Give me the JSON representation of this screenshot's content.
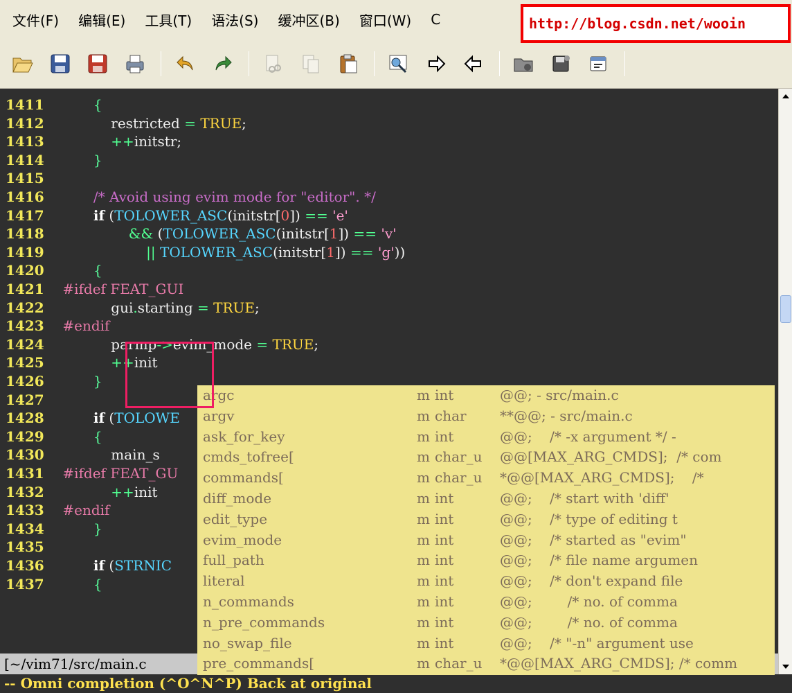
{
  "menu": {
    "items": [
      "文件(F)",
      "编辑(E)",
      "工具(T)",
      "语法(S)",
      "缓冲区(B)",
      "窗口(W)",
      "C"
    ],
    "url_overlay": "http://blog.csdn.net/wooin"
  },
  "toolbar": {
    "icons": [
      "open-icon",
      "save-icon",
      "save-all-icon",
      "print-icon",
      "undo-icon",
      "redo-icon",
      "cut-icon",
      "copy-icon",
      "paste-icon",
      "find-replace-icon",
      "forward-icon",
      "back-icon",
      "load-session-icon",
      "save-session-icon",
      "run-script-icon"
    ]
  },
  "editor": {
    "lines": [
      {
        "num": "1411",
        "code": [
          [
            "        ",
            ""
          ],
          [
            "{",
            "brace"
          ]
        ]
      },
      {
        "num": "1412",
        "code": [
          [
            "            restricted ",
            ""
          ],
          [
            "=",
            "op"
          ],
          [
            " ",
            ""
          ],
          [
            "TRUE",
            "const"
          ],
          [
            ";",
            ""
          ]
        ]
      },
      {
        "num": "1413",
        "code": [
          [
            "            ",
            ""
          ],
          [
            "++",
            "op"
          ],
          [
            "initstr;",
            ""
          ]
        ]
      },
      {
        "num": "1414",
        "code": [
          [
            "        ",
            ""
          ],
          [
            "}",
            "brace"
          ]
        ]
      },
      {
        "num": "1415",
        "code": []
      },
      {
        "num": "1416",
        "code": [
          [
            "        ",
            ""
          ],
          [
            "/* Avoid using evim mode for \"editor\". */",
            "cm"
          ]
        ]
      },
      {
        "num": "1417",
        "code": [
          [
            "        ",
            ""
          ],
          [
            "if",
            "kw"
          ],
          [
            " (",
            ""
          ],
          [
            "TOLOWER_ASC",
            "mac"
          ],
          [
            "(initstr[",
            ""
          ],
          [
            "0",
            "num"
          ],
          [
            "]) ",
            ""
          ],
          [
            "==",
            "op"
          ],
          [
            " ",
            ""
          ],
          [
            "'e'",
            "str"
          ]
        ]
      },
      {
        "num": "1418",
        "code": [
          [
            "                ",
            ""
          ],
          [
            "&&",
            "op"
          ],
          [
            " (",
            ""
          ],
          [
            "TOLOWER_ASC",
            "mac"
          ],
          [
            "(initstr[",
            ""
          ],
          [
            "1",
            "num"
          ],
          [
            "]) ",
            ""
          ],
          [
            "==",
            "op"
          ],
          [
            " ",
            ""
          ],
          [
            "'v'",
            "str"
          ]
        ]
      },
      {
        "num": "1419",
        "code": [
          [
            "                    ",
            ""
          ],
          [
            "||",
            "op"
          ],
          [
            " ",
            ""
          ],
          [
            "TOLOWER_ASC",
            "mac"
          ],
          [
            "(initstr[",
            ""
          ],
          [
            "1",
            "num"
          ],
          [
            "]) ",
            ""
          ],
          [
            "==",
            "op"
          ],
          [
            " ",
            ""
          ],
          [
            "'g'",
            "str"
          ],
          [
            "))",
            ""
          ]
        ]
      },
      {
        "num": "1420",
        "code": [
          [
            "        ",
            ""
          ],
          [
            "{",
            "brace"
          ]
        ]
      },
      {
        "num": "1421",
        "code": [
          [
            " ",
            ""
          ],
          [
            "#ifdef FEAT_GUI",
            "pp"
          ]
        ]
      },
      {
        "num": "1422",
        "code": [
          [
            "            gui",
            ""
          ],
          [
            ".",
            "op"
          ],
          [
            "starting ",
            ""
          ],
          [
            "=",
            "op"
          ],
          [
            " ",
            ""
          ],
          [
            "TRUE",
            "const"
          ],
          [
            ";",
            ""
          ]
        ]
      },
      {
        "num": "1423",
        "code": [
          [
            " ",
            ""
          ],
          [
            "#endif",
            "pp"
          ]
        ]
      },
      {
        "num": "1424",
        "code": [
          [
            "            parmp",
            ""
          ],
          [
            "->",
            "op"
          ],
          [
            "evim_mode ",
            ""
          ],
          [
            "=",
            "op"
          ],
          [
            " ",
            ""
          ],
          [
            "TRUE",
            "const"
          ],
          [
            ";",
            ""
          ]
        ]
      },
      {
        "num": "1425",
        "code": [
          [
            "            ",
            ""
          ],
          [
            "++",
            "op"
          ],
          [
            "init",
            ""
          ]
        ]
      },
      {
        "num": "1426",
        "code": [
          [
            "        ",
            ""
          ],
          [
            "}",
            "brace"
          ]
        ]
      },
      {
        "num": "1427",
        "code": []
      },
      {
        "num": "1428",
        "code": [
          [
            "        ",
            ""
          ],
          [
            "if",
            "kw"
          ],
          [
            " (",
            ""
          ],
          [
            "TOLOWE",
            "mac"
          ]
        ]
      },
      {
        "num": "1429",
        "code": [
          [
            "        ",
            ""
          ],
          [
            "{",
            "brace"
          ]
        ]
      },
      {
        "num": "1430",
        "code": [
          [
            "            main_s",
            ""
          ]
        ]
      },
      {
        "num": "1431",
        "code": [
          [
            " ",
            ""
          ],
          [
            "#ifdef FEAT_GU",
            "pp"
          ]
        ]
      },
      {
        "num": "1432",
        "code": [
          [
            "            ",
            ""
          ],
          [
            "++",
            "op"
          ],
          [
            "init",
            ""
          ]
        ]
      },
      {
        "num": "1433",
        "code": [
          [
            " ",
            ""
          ],
          [
            "#endif",
            "pp"
          ]
        ]
      },
      {
        "num": "1434",
        "code": [
          [
            "        ",
            ""
          ],
          [
            "}",
            "brace"
          ]
        ]
      },
      {
        "num": "1435",
        "code": []
      },
      {
        "num": "1436",
        "code": [
          [
            "        ",
            ""
          ],
          [
            "if",
            "kw"
          ],
          [
            " (",
            ""
          ],
          [
            "STRNIC",
            "mac"
          ]
        ]
      },
      {
        "num": "1437",
        "code": [
          [
            "        ",
            ""
          ],
          [
            "{",
            "brace"
          ]
        ]
      }
    ]
  },
  "statusline": "[~/vim71/src/main.c",
  "cmdline": "-- Omni completion (^O^N^P) Back at original",
  "popup": {
    "items": [
      {
        "name": "argc",
        "kind": "m",
        "type": "int",
        "info": "@@; - src/main.c"
      },
      {
        "name": "argv",
        "kind": "m",
        "type": "char",
        "info": "**@@; - src/main.c"
      },
      {
        "name": "ask_for_key",
        "kind": "m",
        "type": "int",
        "info": "@@;    /* -x argument */ -"
      },
      {
        "name": "cmds_tofree[",
        "kind": "m",
        "type": "char_u",
        "info": "@@[MAX_ARG_CMDS];  /* com"
      },
      {
        "name": "commands[",
        "kind": "m",
        "type": "char_u",
        "info": "*@@[MAX_ARG_CMDS];    /*"
      },
      {
        "name": "diff_mode",
        "kind": "m",
        "type": "int",
        "info": "@@;    /* start with 'diff'"
      },
      {
        "name": "edit_type",
        "kind": "m",
        "type": "int",
        "info": "@@;    /* type of editing t"
      },
      {
        "name": "evim_mode",
        "kind": "m",
        "type": "int",
        "info": "@@;    /* started as \"evim\""
      },
      {
        "name": "full_path",
        "kind": "m",
        "type": "int",
        "info": "@@;    /* file name argumen"
      },
      {
        "name": "literal",
        "kind": "m",
        "type": "int",
        "info": "@@;    /* don't expand file"
      },
      {
        "name": "n_commands",
        "kind": "m",
        "type": "int",
        "info": "@@;        /* no. of comma"
      },
      {
        "name": "n_pre_commands",
        "kind": "m",
        "type": "int",
        "info": "@@;        /* no. of comma"
      },
      {
        "name": "no_swap_file",
        "kind": "m",
        "type": "int",
        "info": "@@;    /* \"-n\" argument use"
      },
      {
        "name": "pre_commands[",
        "kind": "m",
        "type": "char_u",
        "info": "*@@[MAX_ARG_CMDS]; /* comm"
      }
    ]
  },
  "scrollbar": {
    "thumb_start_fraction": 0.345,
    "thumb_end_fraction": 0.395
  }
}
